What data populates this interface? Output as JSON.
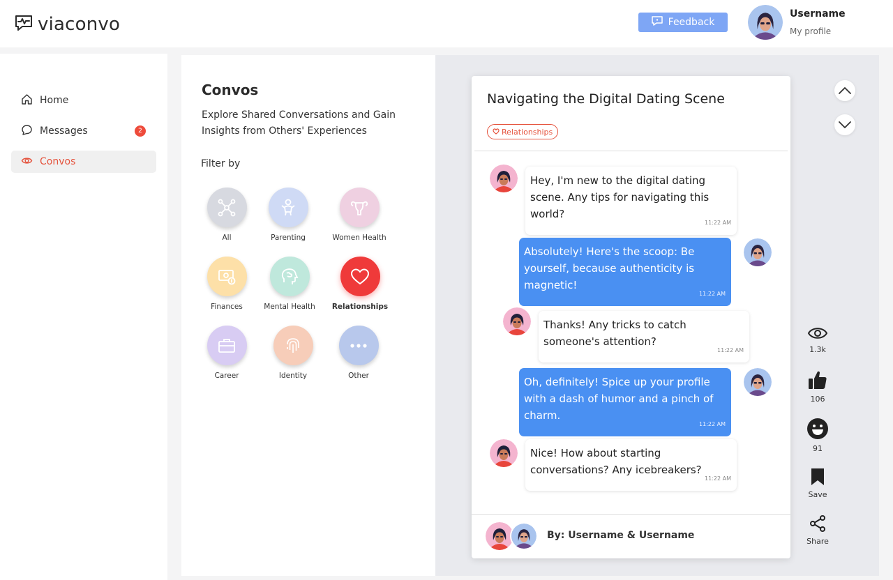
{
  "header": {
    "logo_text": "viaconvo",
    "feedback_label": "Feedback",
    "username": "Username",
    "profile_link": "My profile"
  },
  "sidebar": {
    "items": [
      {
        "label": "Home",
        "icon": "home-icon"
      },
      {
        "label": "Messages",
        "icon": "chat-icon",
        "badge": "2"
      },
      {
        "label": "Convos",
        "icon": "eye-icon",
        "active": true
      }
    ]
  },
  "convos": {
    "title": "Convos",
    "subtitle": "Explore Shared Conversations and Gain Insights from Others' Experiences",
    "filter_label": "Filter by",
    "categories": [
      {
        "label": "All",
        "color": "#d7d9e0",
        "icon": "network-icon"
      },
      {
        "label": "Parenting",
        "color": "#cfdaf5",
        "icon": "baby-icon"
      },
      {
        "label": "Women Health",
        "color": "#efd0e1",
        "icon": "uterus-icon"
      },
      {
        "label": "Finances",
        "color": "#fde0a8",
        "icon": "money-icon"
      },
      {
        "label": "Mental Health",
        "color": "#bfe8dc",
        "icon": "brain-icon"
      },
      {
        "label": "Relationships",
        "color": "#ef3a3a",
        "icon": "heart-icon",
        "active": true
      },
      {
        "label": "Career",
        "color": "#d8ccf3",
        "icon": "briefcase-icon"
      },
      {
        "label": "Identity",
        "color": "#f7cdb9",
        "icon": "fingerprint-icon"
      },
      {
        "label": "Other",
        "color": "#b8c8ec",
        "icon": "more-icon"
      }
    ]
  },
  "conversation": {
    "title": "Navigating the Digital Dating Scene",
    "tag": "Relationships",
    "messages": [
      {
        "side": "in",
        "text": "Hey, I'm new to the digital dating scene. Any tips for navigating this world?",
        "time": "11:22 AM"
      },
      {
        "side": "out",
        "text": "Absolutely! Here's the scoop: Be yourself, because authenticity is magnetic!",
        "time": "11:22 AM"
      },
      {
        "side": "in",
        "text": "Thanks! Any tricks to catch someone's attention?",
        "time": "11:22 AM"
      },
      {
        "side": "out",
        "text": "Oh, definitely! Spice up your profile with a dash of humor and a pinch of charm.",
        "time": "11:22 AM"
      },
      {
        "side": "in",
        "text": "Nice! How about starting conversations? Any icebreakers?",
        "time": "11:22 AM"
      }
    ],
    "by": "By: Username & Username"
  },
  "actions": {
    "views": "1.3k",
    "likes": "106",
    "reactions": "91",
    "save": "Save",
    "share": "Share"
  },
  "colors": {
    "accent": "#e5533d",
    "bubble_blue": "#4a90f2",
    "feedback_blue": "#7ea6f5",
    "badge_red": "#ee4b3b"
  }
}
